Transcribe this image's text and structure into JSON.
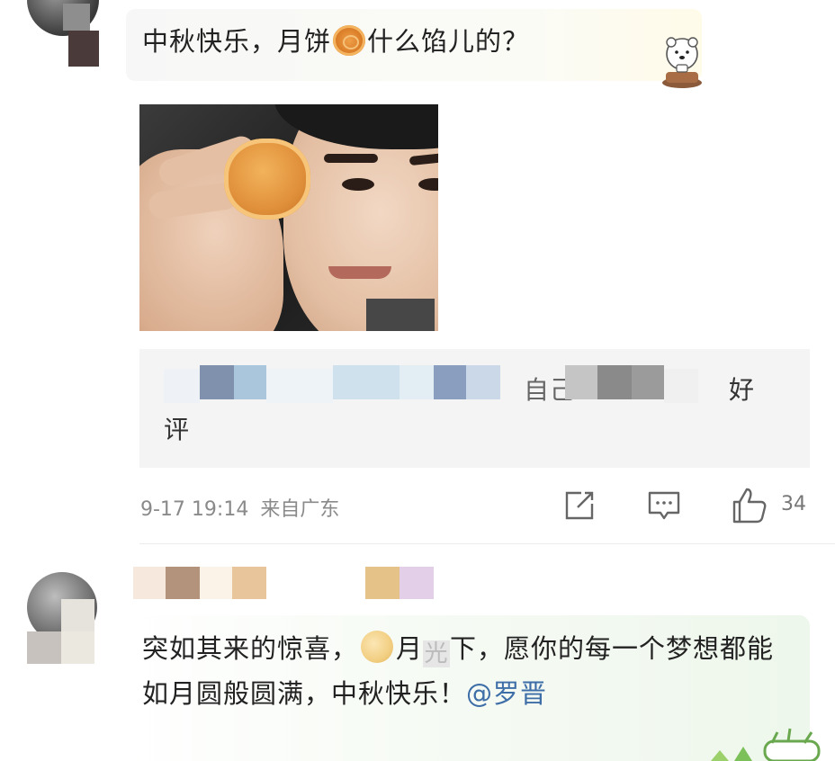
{
  "comment1": {
    "text_before": "中秋快乐，月饼",
    "emoji": "mooncake-emoji",
    "text_after": "什么馅儿的？",
    "sticker": "dog-sticker",
    "quote": {
      "line1_end": "自己",
      "line1_tail": "好",
      "line2": "评"
    },
    "time": "9-17 19:14",
    "source": "来自广东",
    "like_count": "34"
  },
  "comment2": {
    "text_part1": "突如其来的惊喜，",
    "emoji": "moon-emoji",
    "text_part2": "月",
    "smudge_char": "光",
    "text_part3": "下，愿你的每一个梦想都能如月圆般圆满，中秋快乐！",
    "mention": "@罗晋"
  },
  "colors": {
    "accent_link": "#3e6ea8",
    "meta_gray": "#8a8a8a",
    "card_bg": "#f4f4f4"
  }
}
